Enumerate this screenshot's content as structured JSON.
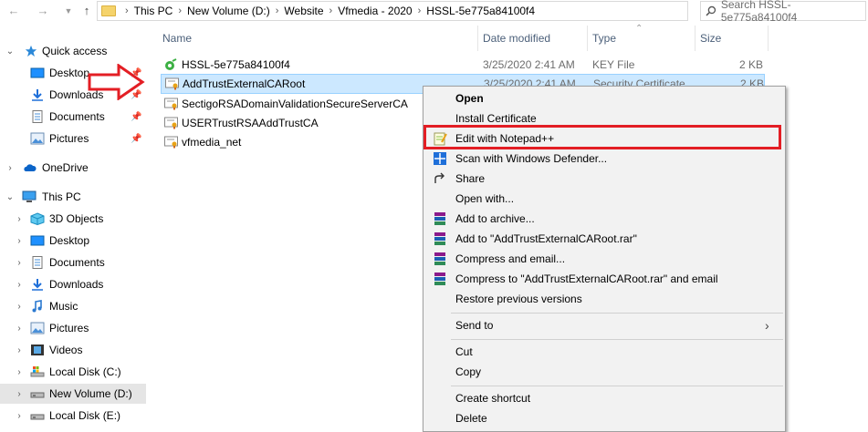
{
  "address": {
    "breadcrumbs": [
      "This PC",
      "New Volume (D:)",
      "Website",
      "Vfmedia - 2020",
      "HSSL-5e775a84100f4"
    ],
    "search_placeholder": "Search HSSL-5e775a84100f4"
  },
  "nav": {
    "quick_access": "Quick access",
    "qa_items": [
      "Desktop",
      "Downloads",
      "Documents",
      "Pictures"
    ],
    "onedrive": "OneDrive",
    "this_pc": "This PC",
    "pc_items": [
      "3D Objects",
      "Desktop",
      "Documents",
      "Downloads",
      "Music",
      "Pictures",
      "Videos",
      "Local Disk (C:)",
      "New Volume (D:)",
      "Local Disk (E:)"
    ]
  },
  "columns": {
    "name": "Name",
    "date": "Date modified",
    "type": "Type",
    "size": "Size"
  },
  "files": [
    {
      "name": "HSSL-5e775a84100f4",
      "date": "3/25/2020 2:41 AM",
      "type": "KEY File",
      "size": "2 KB"
    },
    {
      "name": "AddTrustExternalCARoot",
      "date": "3/25/2020 2:41 AM",
      "type": "Security Certificate",
      "size": "2 KB"
    },
    {
      "name": "SectigoRSADomainValidationSecureServerCA",
      "date": "",
      "type": "",
      "size": ""
    },
    {
      "name": "USERTrustRSAAddTrustCA",
      "date": "",
      "type": "",
      "size": ""
    },
    {
      "name": "vfmedia_net",
      "date": "",
      "type": "",
      "size": ""
    }
  ],
  "context_menu": {
    "open": "Open",
    "install_certificate": "Install Certificate",
    "edit_notepad": "Edit with Notepad++",
    "scan_defender": "Scan with Windows Defender...",
    "share": "Share",
    "open_with": "Open with...",
    "add_archive": "Add to archive...",
    "add_rar": "Add to \"AddTrustExternalCARoot.rar\"",
    "compress_email": "Compress and email...",
    "compress_rar_email": "Compress to \"AddTrustExternalCARoot.rar\" and email",
    "restore_versions": "Restore previous versions",
    "send_to": "Send to",
    "cut": "Cut",
    "copy": "Copy",
    "create_shortcut": "Create shortcut",
    "delete": "Delete"
  },
  "colors": {
    "highlight_border": "#e31e24",
    "selection": "#cce8ff",
    "menu_bg": "#f2f2f2"
  }
}
